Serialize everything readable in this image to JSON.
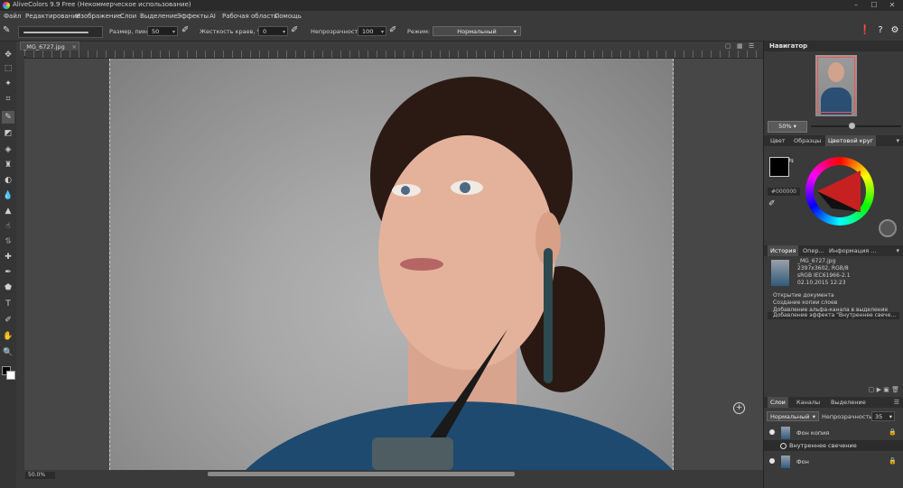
{
  "app": {
    "title": "AliveColors 9.9 Free (Некоммерческое использование)"
  },
  "menu": [
    "Файл",
    "Редактирование",
    "Изображение",
    "Слои",
    "Выделение",
    "Эффекты",
    "AI",
    "Рабочая область",
    "Помощь"
  ],
  "options": {
    "size_label": "Размер, пикс",
    "size_value": "50",
    "hardness_label": "Жесткость краев, %",
    "hardness_value": "0",
    "opacity_label": "Непрозрачность",
    "opacity_value": "100",
    "mode_label": "Режим:",
    "mode_value": "Нормальный"
  },
  "document": {
    "tab_label": "_MG_6727.jpg",
    "zoom": "50.0%"
  },
  "navigator": {
    "title": "Навигатор",
    "zoom": "50%",
    "zoom_fraction": 0.42
  },
  "color_panel": {
    "tabs": [
      "Цвет",
      "Образцы",
      "Цветовой круг"
    ],
    "hex": "#000000",
    "fg_color": "#000000",
    "bg_color": "#ffffff"
  },
  "history_panel": {
    "tabs": [
      "История",
      "Опер...",
      "Информация ..."
    ],
    "file": {
      "name": "_MG_6727.jpg",
      "dims": "2397x3602, RGB/8",
      "profile": "sRGB IEC61966-2.1",
      "date": "02.10.2015 12:23"
    },
    "items": [
      "Открытие документа",
      "Создание копии слоев",
      "Добавление альфа-канала в выделение",
      "Добавление эффекта \"Внутреннее свече..."
    ]
  },
  "layers_panel": {
    "tabs": [
      "Слои",
      "Каналы",
      "Выделение"
    ],
    "blend_mode": "Нормальный",
    "opacity_label": "Непрозрачность",
    "opacity_value": "35",
    "layers": [
      {
        "name": "Фон копия",
        "effect": "Внутреннее свечение"
      },
      {
        "name": "Фон"
      }
    ]
  }
}
